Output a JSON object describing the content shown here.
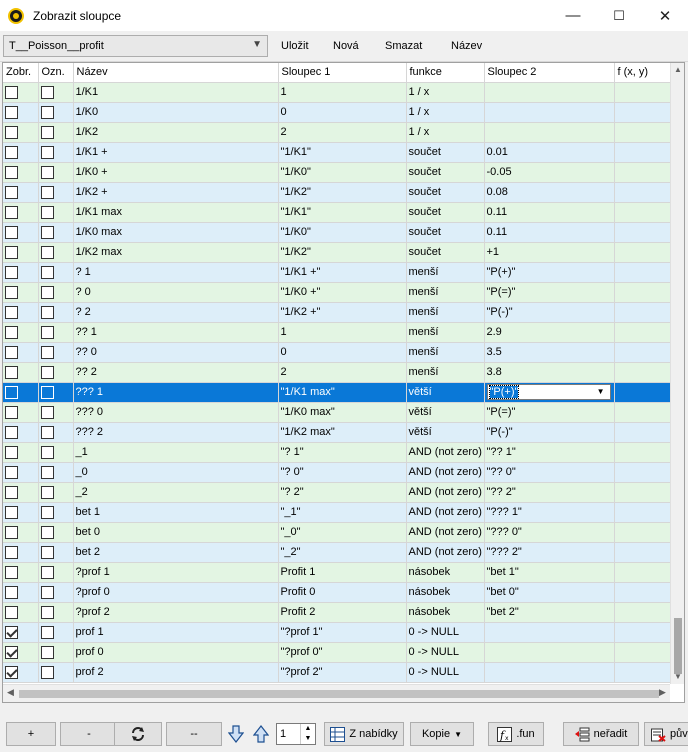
{
  "window": {
    "title": "Zobrazit sloupce",
    "minimize": "—",
    "maximize": "☐",
    "close": "✕"
  },
  "toolbar": {
    "table_select": "T__Poisson__profit",
    "save_label": "Uložit",
    "new_label": "Nová",
    "delete_label": "Smazat",
    "rename_label": "Název"
  },
  "grid": {
    "columns": [
      "Zobr.",
      "Ozn.",
      "Název",
      "Sloupec 1",
      "funkce",
      "Sloupec 2",
      "f (x, y)"
    ],
    "selected_row": 15,
    "rows": [
      {
        "zobr": false,
        "ozn": false,
        "nazev": "1/K1",
        "s1": "1",
        "funkce": "1 / x",
        "s2": "",
        "color": "green"
      },
      {
        "zobr": false,
        "ozn": false,
        "nazev": "1/K0",
        "s1": "0",
        "funkce": "1 / x",
        "s2": "",
        "color": "blue"
      },
      {
        "zobr": false,
        "ozn": false,
        "nazev": "1/K2",
        "s1": "2",
        "funkce": "1 / x",
        "s2": "",
        "color": "green"
      },
      {
        "zobr": false,
        "ozn": false,
        "nazev": "1/K1 +",
        "s1": "\"1/K1\"",
        "funkce": "součet",
        "s2": "0.01",
        "color": "blue"
      },
      {
        "zobr": false,
        "ozn": false,
        "nazev": "1/K0 +",
        "s1": "\"1/K0\"",
        "funkce": "součet",
        "s2": "-0.05",
        "color": "green"
      },
      {
        "zobr": false,
        "ozn": false,
        "nazev": "1/K2 +",
        "s1": "\"1/K2\"",
        "funkce": "součet",
        "s2": "0.08",
        "color": "blue"
      },
      {
        "zobr": false,
        "ozn": false,
        "nazev": "1/K1 max",
        "s1": "\"1/K1\"",
        "funkce": "součet",
        "s2": "0.11",
        "color": "green"
      },
      {
        "zobr": false,
        "ozn": false,
        "nazev": "1/K0 max",
        "s1": "\"1/K0\"",
        "funkce": "součet",
        "s2": "0.11",
        "color": "blue"
      },
      {
        "zobr": false,
        "ozn": false,
        "nazev": "1/K2 max",
        "s1": "\"1/K2\"",
        "funkce": "součet",
        "s2": "+1",
        "color": "green"
      },
      {
        "zobr": false,
        "ozn": false,
        "nazev": "? 1",
        "s1": "\"1/K1 +\"",
        "funkce": "menší",
        "s2": "\"P(+)\"",
        "color": "blue"
      },
      {
        "zobr": false,
        "ozn": false,
        "nazev": "? 0",
        "s1": "\"1/K0 +\"",
        "funkce": "menší",
        "s2": "\"P(=)\"",
        "color": "green"
      },
      {
        "zobr": false,
        "ozn": false,
        "nazev": "? 2",
        "s1": "\"1/K2 +\"",
        "funkce": "menší",
        "s2": "\"P(-)\"",
        "color": "blue"
      },
      {
        "zobr": false,
        "ozn": false,
        "nazev": "?? 1",
        "s1": "1",
        "funkce": "menší",
        "s2": "2.9",
        "color": "green"
      },
      {
        "zobr": false,
        "ozn": false,
        "nazev": "?? 0",
        "s1": "0",
        "funkce": "menší",
        "s2": "3.5",
        "color": "blue"
      },
      {
        "zobr": false,
        "ozn": false,
        "nazev": "?? 2",
        "s1": "2",
        "funkce": "menší",
        "s2": "3.8",
        "color": "green"
      },
      {
        "zobr": false,
        "ozn": false,
        "nazev": "??? 1",
        "s1": "\"1/K1 max\"",
        "funkce": "větší",
        "s2": "\"P(+)\"",
        "color": "sel"
      },
      {
        "zobr": false,
        "ozn": false,
        "nazev": "??? 0",
        "s1": "\"1/K0 max\"",
        "funkce": "větší",
        "s2": "\"P(=)\"",
        "color": "green"
      },
      {
        "zobr": false,
        "ozn": false,
        "nazev": "??? 2",
        "s1": "\"1/K2 max\"",
        "funkce": "větší",
        "s2": "\"P(-)\"",
        "color": "blue"
      },
      {
        "zobr": false,
        "ozn": false,
        "nazev": "_1",
        "s1": "\"? 1\"",
        "funkce": "AND (not zero)",
        "s2": "\"?? 1\"",
        "color": "green"
      },
      {
        "zobr": false,
        "ozn": false,
        "nazev": "_0",
        "s1": "\"? 0\"",
        "funkce": "AND (not zero)",
        "s2": "\"?? 0\"",
        "color": "blue"
      },
      {
        "zobr": false,
        "ozn": false,
        "nazev": "_2",
        "s1": "\"? 2\"",
        "funkce": "AND (not zero)",
        "s2": "\"?? 2\"",
        "color": "green"
      },
      {
        "zobr": false,
        "ozn": false,
        "nazev": "bet 1",
        "s1": "\"_1\"",
        "funkce": "AND (not zero)",
        "s2": "\"??? 1\"",
        "color": "blue"
      },
      {
        "zobr": false,
        "ozn": false,
        "nazev": "bet 0",
        "s1": "\"_0\"",
        "funkce": "AND (not zero)",
        "s2": "\"??? 0\"",
        "color": "green"
      },
      {
        "zobr": false,
        "ozn": false,
        "nazev": "bet 2",
        "s1": "\"_2\"",
        "funkce": "AND (not zero)",
        "s2": "\"??? 2\"",
        "color": "blue"
      },
      {
        "zobr": false,
        "ozn": false,
        "nazev": "?prof 1",
        "s1": "Profit 1",
        "funkce": "násobek",
        "s2": "\"bet 1\"",
        "color": "green"
      },
      {
        "zobr": false,
        "ozn": false,
        "nazev": "?prof 0",
        "s1": "Profit 0",
        "funkce": "násobek",
        "s2": "\"bet 0\"",
        "color": "blue"
      },
      {
        "zobr": false,
        "ozn": false,
        "nazev": "?prof 2",
        "s1": "Profit 2",
        "funkce": "násobek",
        "s2": "\"bet 2\"",
        "color": "green"
      },
      {
        "zobr": true,
        "ozn": false,
        "nazev": "prof 1",
        "s1": "\"?prof 1\"",
        "funkce": "0 -> NULL",
        "s2": "",
        "color": "blue"
      },
      {
        "zobr": true,
        "ozn": false,
        "nazev": "prof 0",
        "s1": "\"?prof 0\"",
        "funkce": "0 -> NULL",
        "s2": "",
        "color": "green"
      },
      {
        "zobr": true,
        "ozn": false,
        "nazev": "prof 2",
        "s1": "\"?prof 2\"",
        "funkce": "0 -> NULL",
        "s2": "",
        "color": "blue"
      }
    ]
  },
  "bottom": {
    "add_label": "+",
    "remove_label": "-",
    "refresh_icon": "refresh-icon",
    "dash_label": "--",
    "spin_value": "1",
    "from_menu_label": "Z nabídky",
    "copy_label": "Kopie",
    "fun_label": ".fun",
    "unsort_label": "neřadit",
    "original_label": "pův"
  },
  "colors": {
    "row_green": "#e3f5e3",
    "row_blue": "#ddeef9",
    "selection": "#0a78d7"
  }
}
